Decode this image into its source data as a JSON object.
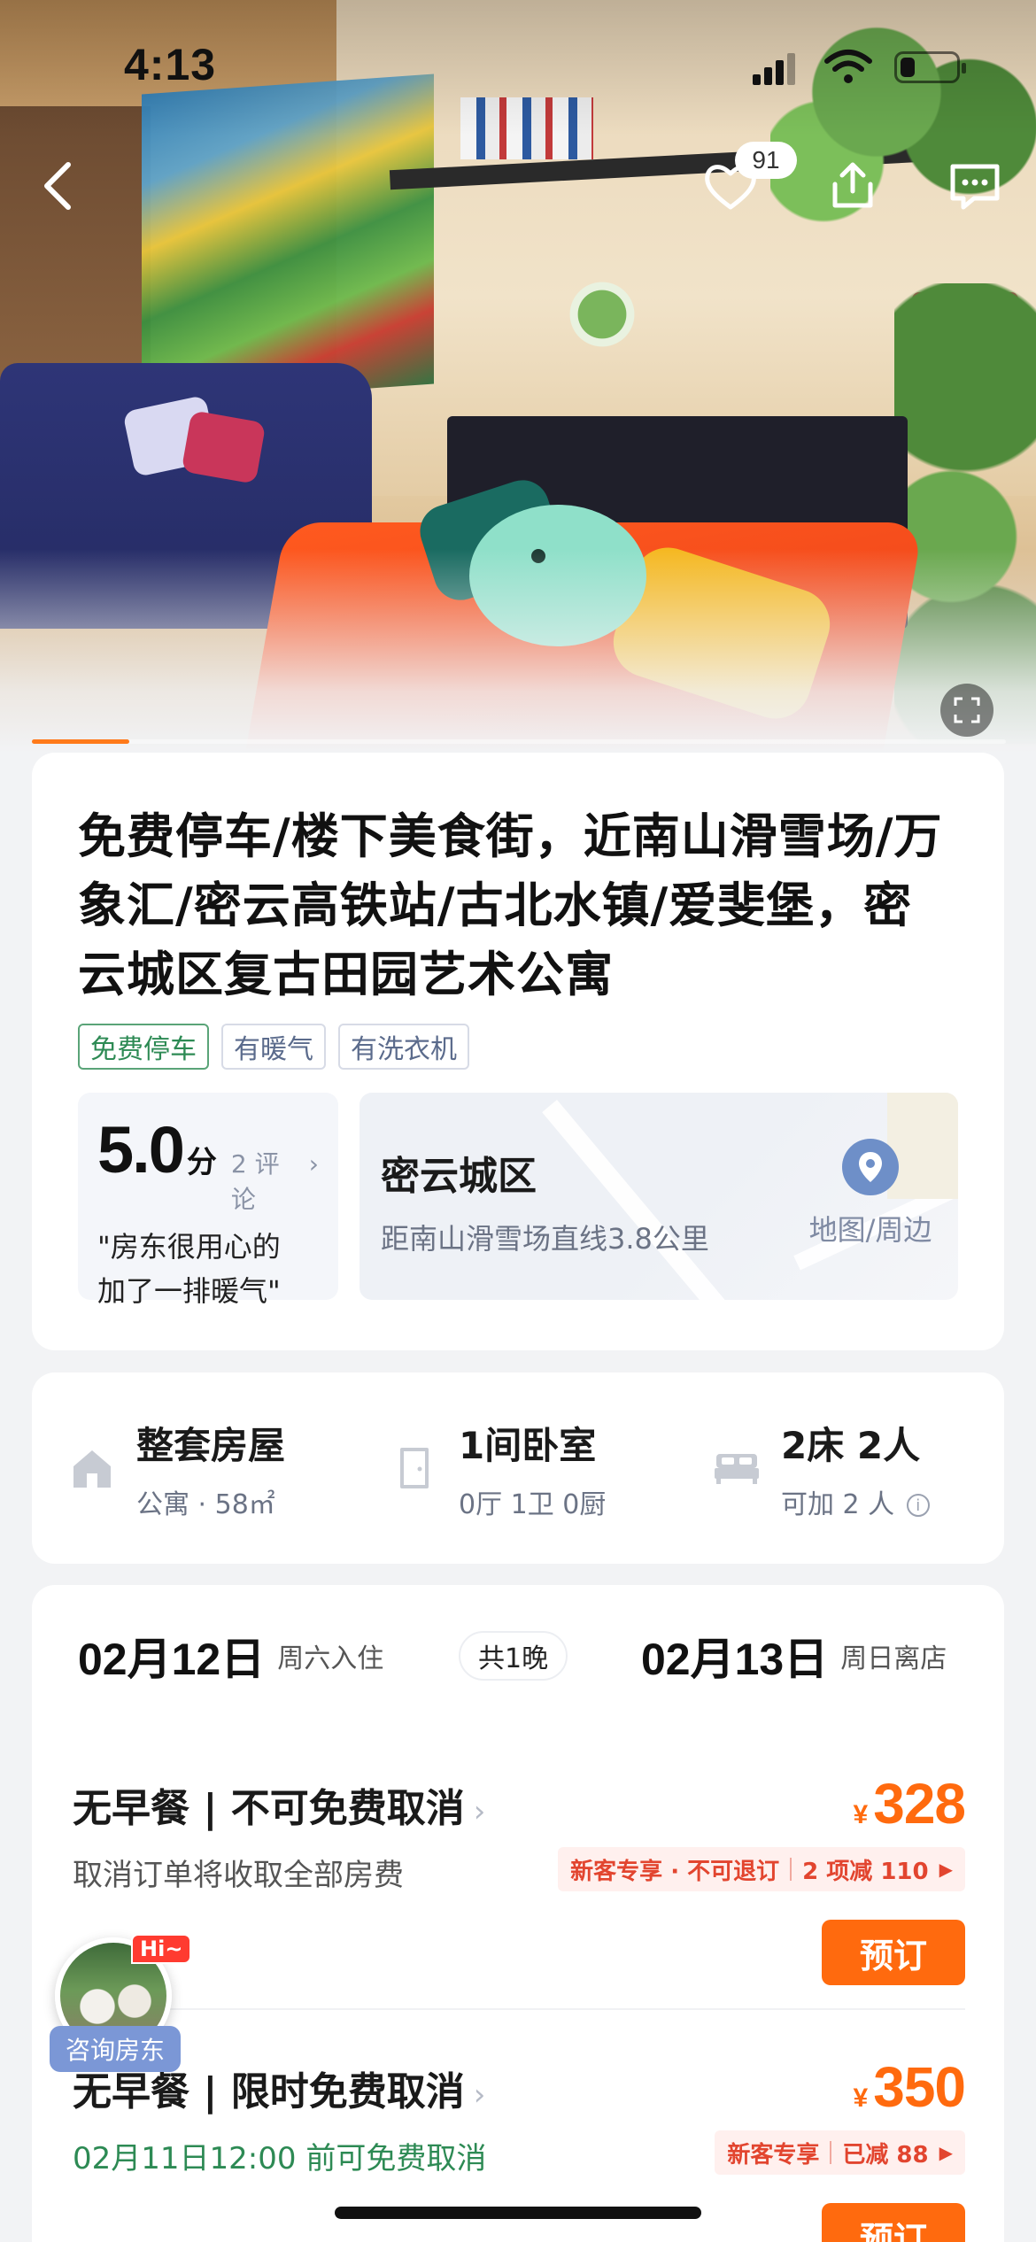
{
  "status_bar": {
    "time": "4:13",
    "battery_level": 0.35
  },
  "header": {
    "favorite_count": "91"
  },
  "media": {
    "progress": 0.1
  },
  "listing": {
    "title": "免费停车/楼下美食街，近南山滑雪场/万象汇/密云高铁站/古北水镇/爱斐堡，密云城区复古田园艺术公寓",
    "tags": [
      {
        "label": "免费停车",
        "style": "green"
      },
      {
        "label": "有暖气",
        "style": "default"
      },
      {
        "label": "有洗衣机",
        "style": "default"
      }
    ],
    "rating": {
      "score": "5.0",
      "unit": "分",
      "reviews": "2 评论",
      "quote_line1": "\"房东很用心的",
      "quote_line2": "加了一排暖气\""
    },
    "location": {
      "area": "密云城区",
      "distance": "距南山滑雪场直线3.8公里",
      "map_label": "地图/周边"
    }
  },
  "room": {
    "type": {
      "title": "整套房屋",
      "sub": "公寓 · 58㎡"
    },
    "bedroom": {
      "title": "1间卧室",
      "sub": "0厅 1卫 0厨"
    },
    "beds": {
      "title": "2床 2人",
      "sub": "可加 2 人"
    }
  },
  "stay": {
    "checkin_date": "02月12日",
    "checkin_label": "周六入住",
    "nights": "共1晚",
    "checkout_date": "02月13日",
    "checkout_label": "周日离店"
  },
  "plans": [
    {
      "name": "无早餐 | 不可免费取消",
      "cancel": "取消订单将收取全部房费",
      "currency": "¥",
      "price": "328",
      "promo_left": "新客专享 · 不可退订",
      "promo_right": "2 项减 110",
      "book": "预订",
      "cancel_color": "gray"
    },
    {
      "name": "无早餐 | 限时免费取消",
      "cancel": "02月11日12:00 前可免费取消",
      "currency": "¥",
      "price": "350",
      "promo_left": "新客专享",
      "promo_right": "已减 88",
      "book": "预订",
      "cancel_color": "green"
    }
  ],
  "host": {
    "badge": "Hi~",
    "label": "咨询房东"
  },
  "colors": {
    "accent": "#ff6a0e",
    "price": "#ff6a0e",
    "green": "#2d8a54",
    "link": "#7f8aa3"
  }
}
